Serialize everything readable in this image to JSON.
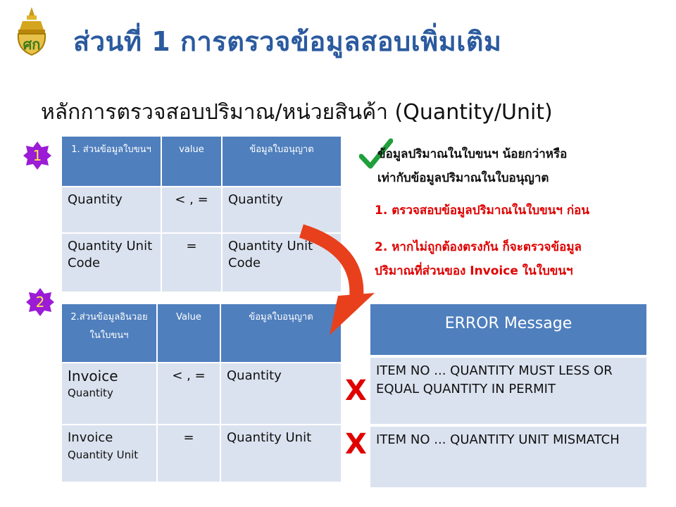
{
  "header": {
    "title": "ส่วนที่ 1  การตรวจข้อมูลสอบเพิ่มเติม",
    "logo_icon": "customs-emblem-icon"
  },
  "subtitle": "หลักการตรวจสอบปริมาณ/หน่วยสินค้า (Quantity/Unit)",
  "table1": {
    "badge": "1",
    "headers": [
      "1. ส่วนข้อมูลใบขนฯ",
      "value",
      "ข้อมูลใบอนุญาต"
    ],
    "rows": [
      [
        "Quantity",
        "< , =",
        "Quantity"
      ],
      [
        "Quantity Unit Code",
        "=",
        "Quantity Unit Code"
      ]
    ]
  },
  "table2": {
    "badge": "2",
    "headers": [
      "2.ส่วนข้อมูลอินวอยในใบขนฯ",
      "Value",
      "ข้อมูลใบอนุญาต"
    ],
    "rows": [
      [
        "Invoice",
        "Quantity",
        "< ,  =",
        "Quantity"
      ],
      [
        "Invoice",
        "Quantity Unit",
        "=",
        "Quantity Unit"
      ]
    ]
  },
  "notes": {
    "check_icon": "checkmark-icon",
    "main": [
      "ข้อมูลปริมาณในใบขนฯ น้อยกว่าหรือ",
      "เท่ากับข้อมูลปริมาณในใบอนุญาต"
    ],
    "step1": "1. ตรวจสอบข้อมูลปริมาณในใบขนฯ ก่อน",
    "step2": [
      "2. หากไม่ถูกต้องตรงกัน ก็จะตรวจข้อมูล",
      "ปริมาณที่ส่วนของ Invoice ในใบขนฯ"
    ]
  },
  "errors": {
    "header": "ERROR Message",
    "marks": [
      "X",
      "X"
    ],
    "rows": [
      "ITEM NO ... QUANTITY MUST LESS OR EQUAL QUANTITY IN PERMIT",
      "ITEM NO ... QUANTITY UNIT MISMATCH"
    ]
  },
  "colors": {
    "title": "#2b5a9e",
    "table_header": "#4f7fbd",
    "table_cell": "#dbe2ef",
    "badge": "#9b1bd6",
    "badge_text": "#ffe84a",
    "red": "#e00000",
    "arrow": "#e8401c",
    "check": "#1fa03a"
  }
}
